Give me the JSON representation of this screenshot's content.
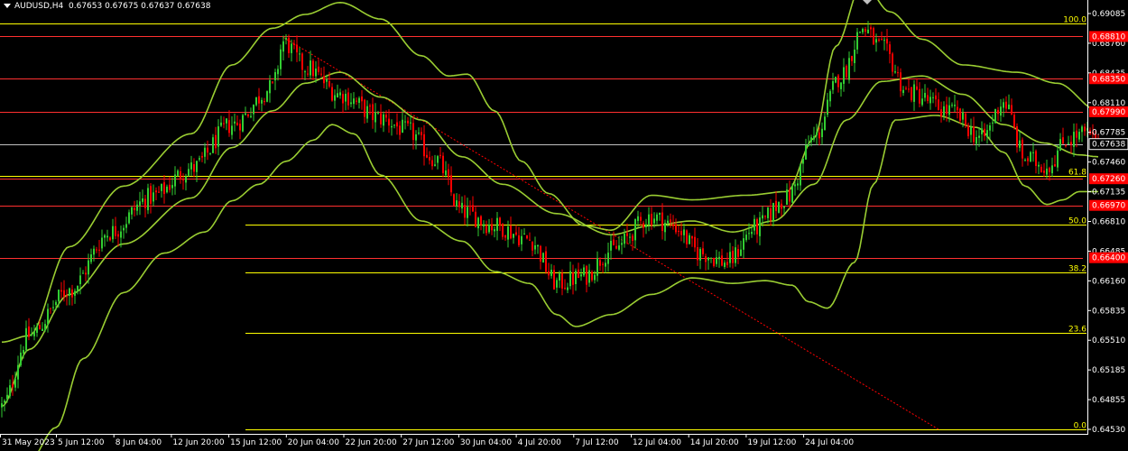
{
  "header": {
    "symbol": "AUDUSD,H4",
    "ohlc": "0.67653 0.67675 0.67637 0.67638"
  },
  "colors": {
    "background": "#000000",
    "bull": "#32cd32",
    "bear": "#ff0000",
    "band": "#9acd32",
    "fib": "#ffff00",
    "hline": "#ff3030",
    "price_line": "#c0c0c0",
    "trend": "#ff0000",
    "axis_text": "#ffffff"
  },
  "chart_data": {
    "type": "candlestick",
    "ylim": [
      0.6453,
      0.6906
    ],
    "y_ticks": [
      "0.69085",
      "0.68760",
      "0.68435",
      "0.68110",
      "0.67785",
      "0.67460",
      "0.67135",
      "0.66810",
      "0.66485",
      "0.66160",
      "0.65835",
      "0.65510",
      "0.65185",
      "0.64855",
      "0.64530"
    ],
    "x_ticks": [
      "31 May 2023",
      "5 Jun 12:00",
      "8 Jun 04:00",
      "12 Jun 20:00",
      "15 Jun 12:00",
      "20 Jun 04:00",
      "22 Jun 20:00",
      "27 Jun 12:00",
      "30 Jun 04:00",
      "4 Jul 20:00",
      "7 Jul 12:00",
      "12 Jul 04:00",
      "14 Jul 20:00",
      "19 Jul 12:00",
      "24 Jul 04:00"
    ],
    "close_anchors": [
      [
        0,
        0.6478
      ],
      [
        10,
        0.6555
      ],
      [
        25,
        0.6605
      ],
      [
        40,
        0.6668
      ],
      [
        55,
        0.6706
      ],
      [
        70,
        0.6737
      ],
      [
        85,
        0.6785
      ],
      [
        100,
        0.6825
      ],
      [
        104,
        0.6875
      ],
      [
        112,
        0.6848
      ],
      [
        125,
        0.6818
      ],
      [
        140,
        0.6792
      ],
      [
        150,
        0.6778
      ],
      [
        160,
        0.6748
      ],
      [
        170,
        0.669
      ],
      [
        182,
        0.6675
      ],
      [
        195,
        0.666
      ],
      [
        205,
        0.6612
      ],
      [
        215,
        0.662
      ],
      [
        225,
        0.6648
      ],
      [
        240,
        0.6685
      ],
      [
        248,
        0.6675
      ],
      [
        258,
        0.6645
      ],
      [
        268,
        0.6635
      ],
      [
        278,
        0.6672
      ],
      [
        290,
        0.6705
      ],
      [
        300,
        0.677
      ],
      [
        310,
        0.6838
      ],
      [
        318,
        0.689
      ],
      [
        325,
        0.6868
      ],
      [
        335,
        0.682
      ],
      [
        350,
        0.68
      ],
      [
        362,
        0.677
      ],
      [
        370,
        0.681
      ],
      [
        378,
        0.6748
      ],
      [
        386,
        0.674
      ],
      [
        394,
        0.677
      ],
      [
        400,
        0.6775
      ],
      [
        405,
        0.6764
      ]
    ],
    "upper_band_anchors": [
      [
        0,
        0.6548
      ],
      [
        10,
        0.6555
      ],
      [
        25,
        0.6652
      ],
      [
        45,
        0.6718
      ],
      [
        70,
        0.6775
      ],
      [
        85,
        0.685
      ],
      [
        100,
        0.689
      ],
      [
        112,
        0.6905
      ],
      [
        125,
        0.6918
      ],
      [
        140,
        0.69
      ],
      [
        155,
        0.686
      ],
      [
        165,
        0.6838
      ],
      [
        172,
        0.684
      ],
      [
        182,
        0.68
      ],
      [
        192,
        0.6745
      ],
      [
        202,
        0.671
      ],
      [
        215,
        0.6675
      ],
      [
        225,
        0.667
      ],
      [
        240,
        0.6708
      ],
      [
        255,
        0.6703
      ],
      [
        275,
        0.6708
      ],
      [
        290,
        0.6712
      ],
      [
        300,
        0.677
      ],
      [
        308,
        0.687
      ],
      [
        318,
        0.694
      ],
      [
        328,
        0.6908
      ],
      [
        340,
        0.6878
      ],
      [
        355,
        0.685
      ],
      [
        375,
        0.6842
      ],
      [
        390,
        0.683
      ],
      [
        405,
        0.68
      ]
    ],
    "middle_band_anchors": [
      [
        0,
        0.6478
      ],
      [
        10,
        0.654
      ],
      [
        25,
        0.66
      ],
      [
        45,
        0.6655
      ],
      [
        70,
        0.6705
      ],
      [
        85,
        0.676
      ],
      [
        100,
        0.68
      ],
      [
        112,
        0.683
      ],
      [
        125,
        0.6842
      ],
      [
        140,
        0.6815
      ],
      [
        155,
        0.679
      ],
      [
        170,
        0.675
      ],
      [
        185,
        0.672
      ],
      [
        205,
        0.6688
      ],
      [
        225,
        0.6665
      ],
      [
        240,
        0.6675
      ],
      [
        255,
        0.668
      ],
      [
        270,
        0.6668
      ],
      [
        285,
        0.668
      ],
      [
        300,
        0.672
      ],
      [
        312,
        0.679
      ],
      [
        325,
        0.6832
      ],
      [
        340,
        0.6838
      ],
      [
        355,
        0.6818
      ],
      [
        370,
        0.6785
      ],
      [
        385,
        0.6765
      ],
      [
        398,
        0.6752
      ],
      [
        405,
        0.675
      ]
    ],
    "lower_band_anchors": [
      [
        0,
        0.6425
      ],
      [
        10,
        0.6418
      ],
      [
        20,
        0.6455
      ],
      [
        30,
        0.653
      ],
      [
        45,
        0.6602
      ],
      [
        60,
        0.6645
      ],
      [
        75,
        0.6668
      ],
      [
        85,
        0.6702
      ],
      [
        95,
        0.672
      ],
      [
        105,
        0.6745
      ],
      [
        115,
        0.6768
      ],
      [
        122,
        0.6785
      ],
      [
        130,
        0.6775
      ],
      [
        140,
        0.673
      ],
      [
        155,
        0.668
      ],
      [
        170,
        0.6658
      ],
      [
        182,
        0.6625
      ],
      [
        195,
        0.6612
      ],
      [
        205,
        0.6578
      ],
      [
        212,
        0.6565
      ],
      [
        225,
        0.6578
      ],
      [
        240,
        0.66
      ],
      [
        255,
        0.6618
      ],
      [
        270,
        0.6612
      ],
      [
        282,
        0.6615
      ],
      [
        292,
        0.661
      ],
      [
        298,
        0.6592
      ],
      [
        305,
        0.6585
      ],
      [
        315,
        0.6635
      ],
      [
        322,
        0.672
      ],
      [
        330,
        0.679
      ],
      [
        345,
        0.6795
      ],
      [
        360,
        0.6782
      ],
      [
        370,
        0.6755
      ],
      [
        378,
        0.6718
      ],
      [
        386,
        0.6698
      ],
      [
        392,
        0.6703
      ],
      [
        398,
        0.6712
      ],
      [
        405,
        0.6712
      ]
    ],
    "candle_count": 406,
    "horizontal_levels": [
      {
        "price": 0.6881,
        "label": "0.68810",
        "kind": "red"
      },
      {
        "price": 0.6835,
        "label": "0.68350",
        "kind": "red"
      },
      {
        "price": 0.6799,
        "label": "0.67990",
        "kind": "red"
      },
      {
        "price": 0.67638,
        "label": "0.67638",
        "kind": "current"
      },
      {
        "price": 0.6726,
        "label": "0.67260",
        "kind": "red"
      },
      {
        "price": 0.6697,
        "label": "0.66970",
        "kind": "red"
      },
      {
        "price": 0.664,
        "label": "0.66400",
        "kind": "red"
      }
    ],
    "fib_levels": [
      {
        "pct": "100.0",
        "price": 0.6895,
        "from_x": 0
      },
      {
        "pct": "61.8",
        "price": 0.6729,
        "from_x": 0
      },
      {
        "pct": "50.0",
        "price": 0.6676,
        "from_x": 272
      },
      {
        "pct": "38.2",
        "price": 0.6624,
        "from_x": 272
      },
      {
        "pct": "23.6",
        "price": 0.6558,
        "from_x": 272
      },
      {
        "pct": "0.0",
        "price": 0.6453,
        "from_x": 272
      }
    ],
    "trendline": {
      "from": [
        104,
        0.688
      ],
      "to": [
        346,
        0.6453
      ]
    }
  }
}
